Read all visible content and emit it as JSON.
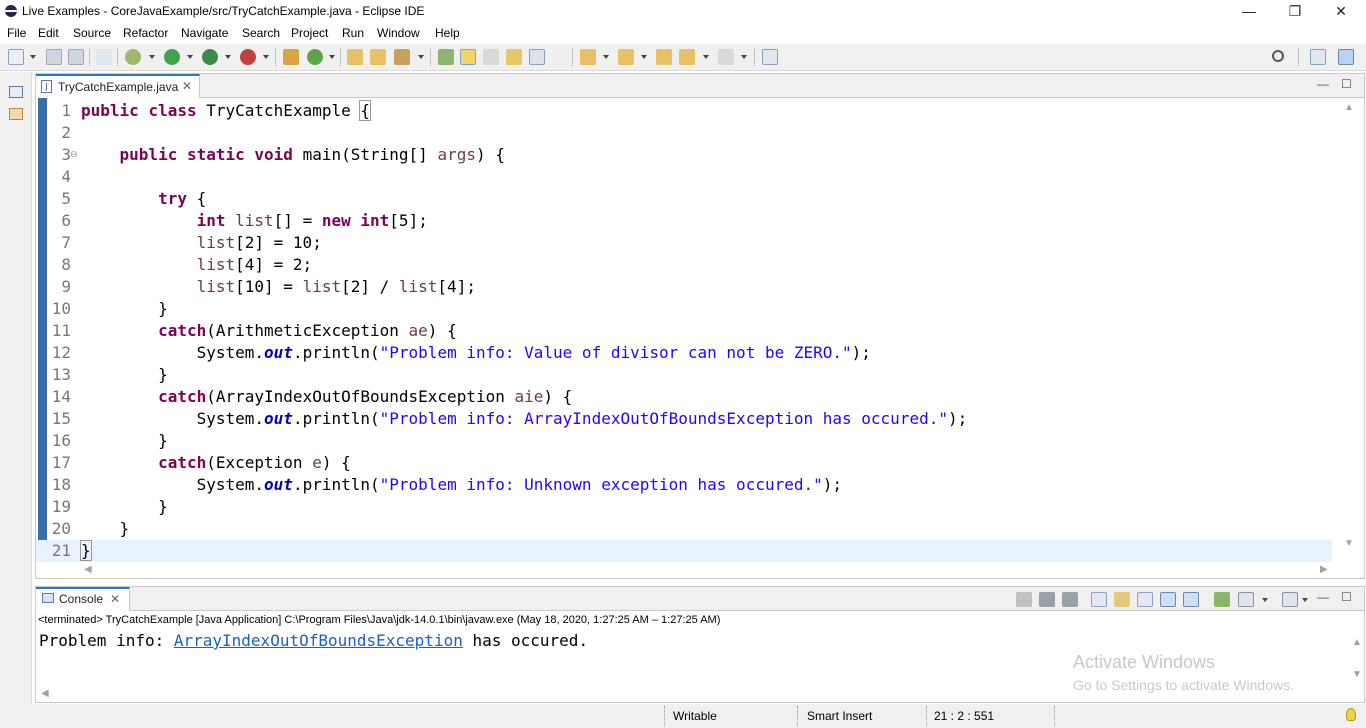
{
  "window": {
    "title": "Live Examples - CoreJavaExample/src/TryCatchExample.java - Eclipse IDE",
    "controls": {
      "minimize": "—",
      "restore": "❐",
      "close": "✕"
    }
  },
  "menu": [
    {
      "label": "File",
      "name": "menu-file"
    },
    {
      "label": "Edit",
      "name": "menu-edit"
    },
    {
      "label": "Source",
      "name": "menu-source"
    },
    {
      "label": "Refactor",
      "name": "menu-refactor"
    },
    {
      "label": "Navigate",
      "name": "menu-navigate"
    },
    {
      "label": "Search",
      "name": "menu-search"
    },
    {
      "label": "Project",
      "name": "menu-project"
    },
    {
      "label": "Run",
      "name": "menu-run"
    },
    {
      "label": "Window",
      "name": "menu-window"
    },
    {
      "label": "Help",
      "name": "menu-help"
    }
  ],
  "editor": {
    "tab_label": "TryCatchExample.java",
    "tab_icon": "java-file-icon",
    "tab_close": "✕",
    "panel_minimize": "—",
    "panel_maximize": "☐",
    "line_numbers": [
      "1",
      "2",
      "3",
      "4",
      "5",
      "6",
      "7",
      "8",
      "9",
      "10",
      "11",
      "12",
      "13",
      "14",
      "15",
      "16",
      "17",
      "18",
      "19",
      "20",
      "21"
    ],
    "current_line": 21
  },
  "console": {
    "tab_label": "Console",
    "tab_close": "✕",
    "terminated_text": "<terminated> TryCatchExample [Java Application] C:\\Program Files\\Java\\jdk-14.0.1\\bin\\javaw.exe  (May 18, 2020, 1:27:25 AM – 1:27:25 AM)",
    "output_prefix": "Problem info: ",
    "output_link": "ArrayIndexOutOfBoundsException",
    "output_suffix": " has occured."
  },
  "watermark": {
    "title": "Activate Windows",
    "subtitle": "Go to Settings to activate Windows."
  },
  "status": {
    "writable": "Writable",
    "insert_mode": "Smart Insert",
    "position": "21 : 2 : 551"
  },
  "colors": {
    "keyword": "#7f0055",
    "string": "#2a00ff",
    "static_field": "#0000c0",
    "local_var": "#6a3e3e",
    "accent": "#2a78c9"
  }
}
